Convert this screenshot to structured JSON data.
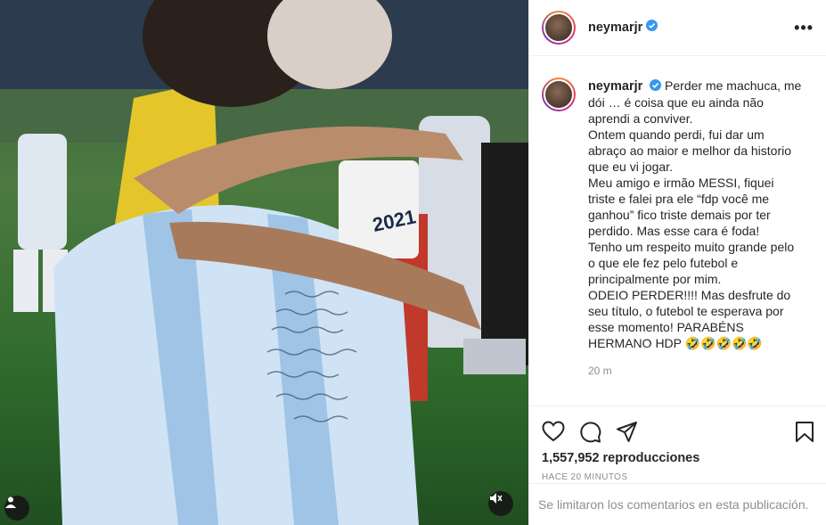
{
  "post": {
    "author": "neymarjr",
    "verified": true,
    "more_label": "•••",
    "caption_lines": [
      "Perder me machuca, me",
      "dói … é coisa que eu ainda não",
      "aprendi a conviver.",
      "Ontem quando perdi, fui dar um",
      "abraço ao maior e melhor da historio",
      "que eu vi jogar.",
      "Meu amigo e irmão MESSI, fiquei",
      "triste e falei pra ele “fdp você me",
      "ganhou” fico triste demais por ter",
      "perdido. Mas esse cara é foda!",
      "Tenho um respeito muito grande pelo",
      "o que ele fez pelo futebol e",
      "principalmente por mim.",
      "ODEIO PERDER!!!! Mas desfrute do",
      "seu título, o futebol te esperava por",
      "esse momento! PARABÉNS",
      "HERMANO HDP 🤣🤣🤣🤣🤣"
    ],
    "caption_age": "20 m",
    "views": "1,557,952 reproducciones",
    "posted": "HACE 20 MINUTOS",
    "comments_disabled": "Se limitaron los comentarios en esta publicación."
  },
  "media": {
    "jersey_number": "2021"
  },
  "icons": {
    "like": "heart-icon",
    "comment": "comment-icon",
    "share": "share-icon",
    "save": "bookmark-icon",
    "tag": "user-tag-icon",
    "mute": "muted-speaker-icon",
    "verified": "verified-badge-icon"
  },
  "colors": {
    "verified": "#3897f0",
    "muted_text": "#8e8e8e"
  }
}
